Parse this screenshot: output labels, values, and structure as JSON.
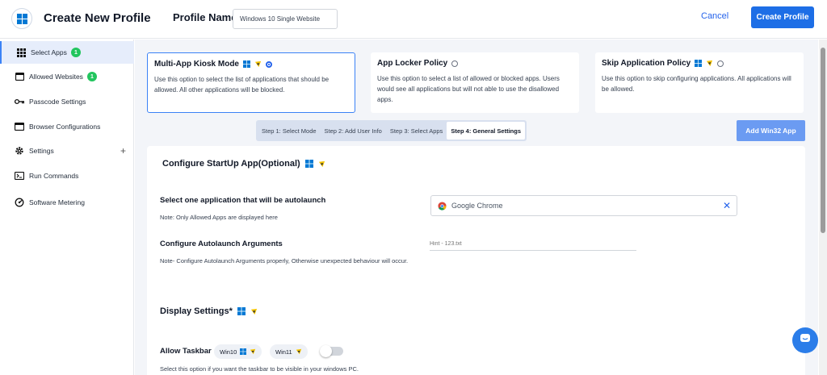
{
  "header": {
    "title": "Create New Profile",
    "profile_name_label": "Profile Name",
    "profile_name_value": "Windows 10 Single Website",
    "cancel_label": "Cancel",
    "create_label": "Create Profile"
  },
  "sidebar": {
    "items": [
      {
        "label": "Select Apps",
        "badge": "1",
        "icon": "grid-icon"
      },
      {
        "label": "Allowed Websites",
        "badge": "1",
        "icon": "browser-icon"
      },
      {
        "label": "Passcode Settings",
        "icon": "key-icon"
      },
      {
        "label": "Browser Configurations",
        "icon": "window-icon"
      },
      {
        "label": "Settings",
        "icon": "gear-icon",
        "expand": "+"
      },
      {
        "label": "Run Commands",
        "icon": "terminal-icon"
      },
      {
        "label": "Software Metering",
        "icon": "gauge-icon"
      }
    ]
  },
  "policies": [
    {
      "title": "Multi-App Kiosk Mode",
      "desc": "Use this option to select the list of applications that should be allowed. All other applications will be blocked.",
      "selected": true
    },
    {
      "title": "App Locker Policy",
      "desc": "Use this option to select a list of allowed or blocked apps. Users would see all applications but will not able to use the disallowed apps.",
      "selected": false
    },
    {
      "title": "Skip Application Policy",
      "desc": "Use this option to skip configuring applications. All applications will be allowed.",
      "selected": false
    }
  ],
  "steps": [
    "Step 1: Select Mode",
    "Step 2: Add User Info",
    "Step 3: Select Apps",
    "Step 4: General Settings"
  ],
  "add_win32_label": "Add Win32 App",
  "startup": {
    "title": "Configure StartUp App(Optional)",
    "select_label": "Select one application that will be autolaunch",
    "select_note": "Note: Only Allowed Apps are displayed here",
    "selected_app": "Google Chrome",
    "clear_symbol": "✕",
    "args_label": "Configure Autolaunch Arguments",
    "args_note": "Note- Configure Autolaunch Arguments properly, Otherwise unexpected behaviour will occur.",
    "args_placeholder": "Hint - 123.txt"
  },
  "display": {
    "title": "Display Settings*",
    "taskbar_label": "Allow Taskbar",
    "chip1": "Win10",
    "chip2": "Win11",
    "taskbar_note": "Select this option if you want the taskbar to be visible in your windows PC.",
    "taskbar_enabled": false
  },
  "colors": {
    "accent": "#1d6ee6",
    "badge": "#22c55e",
    "win_blue": "#0078d4",
    "android_yellow": "#f5c400"
  }
}
